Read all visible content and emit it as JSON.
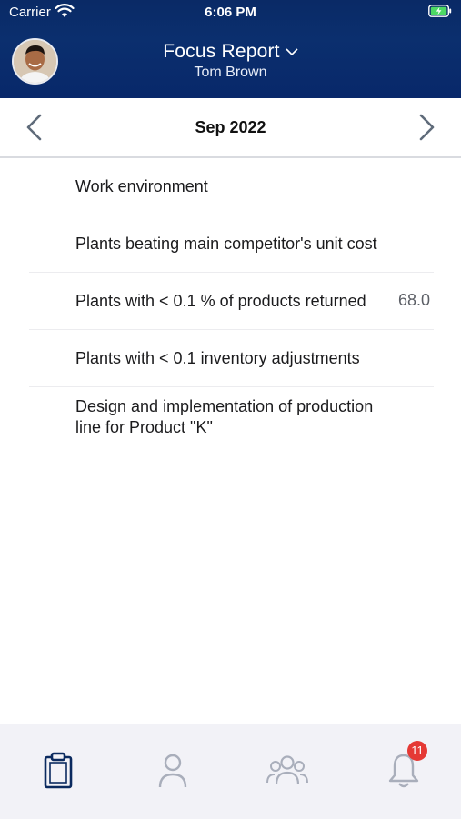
{
  "status_bar": {
    "carrier": "Carrier",
    "time": "6:06 PM"
  },
  "header": {
    "title": "Focus Report",
    "subtitle": "Tom Brown"
  },
  "period": {
    "label": "Sep 2022"
  },
  "items": [
    {
      "label": "Work environment",
      "value": ""
    },
    {
      "label": "Plants beating main competitor's unit cost",
      "value": ""
    },
    {
      "label": "Plants with < 0.1 % of products returned",
      "value": "68.0"
    },
    {
      "label": "Plants with < 0.1 inventory adjustments",
      "value": ""
    },
    {
      "label": "Design and implementation of production line for Product \"K\"",
      "value": ""
    }
  ],
  "tab_bar": {
    "tabs": [
      {
        "icon": "clipboard-icon",
        "active": true
      },
      {
        "icon": "person-icon",
        "active": false
      },
      {
        "icon": "group-icon",
        "active": false
      },
      {
        "icon": "bell-icon",
        "active": false,
        "badge": "11"
      }
    ]
  },
  "colors": {
    "header_bg": "#0b2f6e",
    "active_tab": "#0b2a5f",
    "inactive_tab": "#a9aebb",
    "badge": "#e53935"
  }
}
